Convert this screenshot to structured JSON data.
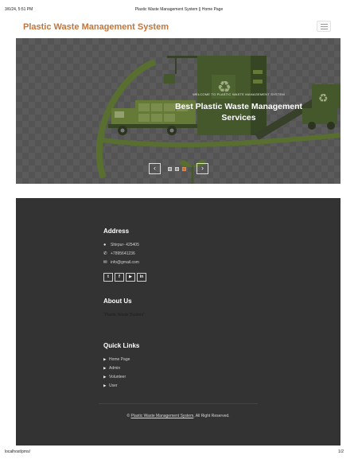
{
  "print_header": {
    "datetime": "3/6/24, 5:51 PM",
    "page_title": "Plastic Waste Management System || Home Page"
  },
  "navbar": {
    "brand": "Plastic Waste Management System",
    "menu_icon": "hamburger-icon"
  },
  "hero": {
    "eyebrow": "WELCOME TO PLASTIC WASTE MANAGEMENT SYSTEM",
    "title": "Best Plastic Waste Management Services",
    "prev_icon": "chevron-left-icon",
    "next_icon": "chevron-right-icon",
    "slide_count": 3,
    "active_slide": 3,
    "colors": {
      "art_green": "#4f6b2e",
      "dark_green": "#3c5223",
      "light_green": "#7c9a3c"
    }
  },
  "footer": {
    "address": {
      "heading": "Address",
      "location": "Shirpur- 425405",
      "phone": "+7895641236",
      "email": "info@gmail.com"
    },
    "socials": [
      {
        "name": "twitter",
        "glyph": "t"
      },
      {
        "name": "facebook",
        "glyph": "f"
      },
      {
        "name": "youtube",
        "glyph": "▶"
      },
      {
        "name": "linkedin",
        "glyph": "in"
      }
    ],
    "about": {
      "heading": "About Us",
      "text": "\"Plastic Waste Busters\""
    },
    "quick_links": {
      "heading": "Quick Links",
      "items": [
        "Home Page",
        "Admin",
        "Volunteer",
        "User"
      ]
    },
    "copyright": {
      "prefix": "©",
      "link": "Plastic Waste Management System",
      "suffix": ", All Right Reserved."
    }
  },
  "print_footer": {
    "url": "localhost/pms/",
    "page": "1/2"
  }
}
